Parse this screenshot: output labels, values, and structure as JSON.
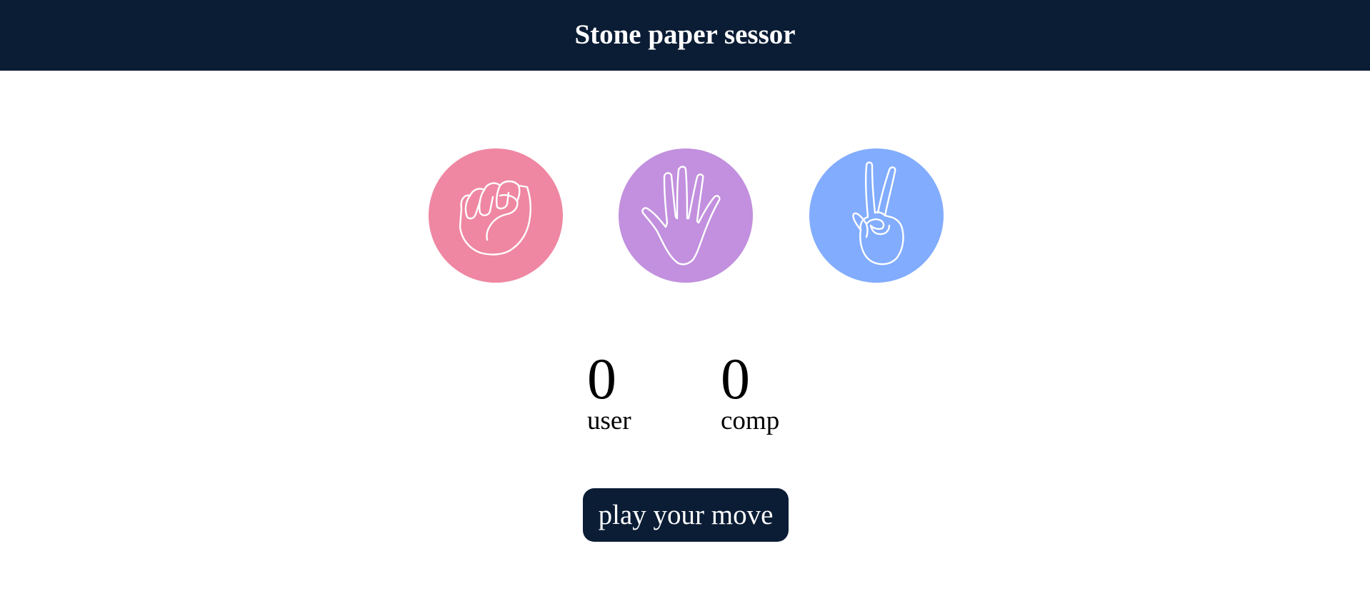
{
  "header": {
    "title": "Stone paper sessor"
  },
  "choices": [
    {
      "name": "stone",
      "icon": "fist-hand-icon",
      "color": "#ef87a2"
    },
    {
      "name": "paper",
      "icon": "open-hand-icon",
      "color": "#c290de"
    },
    {
      "name": "scissor",
      "icon": "peace-hand-icon",
      "color": "#82acfd"
    }
  ],
  "scores": {
    "user": {
      "value": "0",
      "label": "user"
    },
    "comp": {
      "value": "0",
      "label": "comp"
    }
  },
  "message": {
    "text": "play your move"
  },
  "colors": {
    "header_bg": "#0b1d35",
    "button_bg": "#0b1d35",
    "text": "#000000"
  }
}
